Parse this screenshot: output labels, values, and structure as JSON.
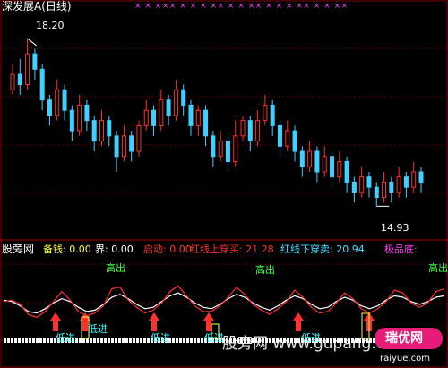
{
  "header": {
    "title": "深发展A(日线)",
    "title_color": "#ffffff",
    "high_marker": "18.20",
    "low_marker": "14.93",
    "x_marks": "× × ×××  × × ×    ×× ×   ×  ××  ×   × ×  ××   ×  ×  ××"
  },
  "indicator_bar": {
    "name": "股旁网",
    "items": [
      {
        "label": "备钱:",
        "value": "0.00",
        "color": "#ffff40"
      },
      {
        "label": "界:",
        "value": "0.00",
        "color": "#ffffff"
      },
      {
        "label": "启动:",
        "value": "0.00",
        "color": "#ff3030"
      },
      {
        "label": "红线上穿买:",
        "value": "21.28",
        "color": "#ff3030"
      },
      {
        "label": "红线下穿卖:",
        "value": "20.94",
        "color": "#40e0ff"
      },
      {
        "label": "极品底:",
        "value": "",
        "color": "#ff40ff"
      }
    ]
  },
  "signals": {
    "sell_text": "高出",
    "buy_text": "低进"
  },
  "watermark": {
    "text": "股旁网 www.gupang.com",
    "badge": "瑞优网",
    "site": "raiyue.com"
  },
  "chart_data": [
    {
      "type": "candlestick",
      "title": "深发展A(日线)",
      "annotations": {
        "high": 18.2,
        "low": 14.93
      },
      "ylim": [
        14.5,
        18.6
      ],
      "colors": {
        "up": "#ff3030",
        "down": "#40d0ff"
      },
      "candles": [
        {
          "o": 17.2,
          "c": 17.5,
          "h": 17.7,
          "l": 17.1
        },
        {
          "o": 17.5,
          "c": 17.3,
          "h": 17.8,
          "l": 17.1
        },
        {
          "o": 17.3,
          "c": 17.9,
          "h": 18.2,
          "l": 17.2
        },
        {
          "o": 17.9,
          "c": 17.6,
          "h": 18.0,
          "l": 17.4
        },
        {
          "o": 17.6,
          "c": 17.0,
          "h": 17.7,
          "l": 16.8
        },
        {
          "o": 17.0,
          "c": 16.7,
          "h": 17.1,
          "l": 16.5
        },
        {
          "o": 16.7,
          "c": 17.2,
          "h": 17.4,
          "l": 16.6
        },
        {
          "o": 17.2,
          "c": 16.8,
          "h": 17.3,
          "l": 16.6
        },
        {
          "o": 16.8,
          "c": 16.4,
          "h": 16.9,
          "l": 16.2
        },
        {
          "o": 16.4,
          "c": 16.9,
          "h": 17.1,
          "l": 16.3
        },
        {
          "o": 16.9,
          "c": 16.6,
          "h": 17.0,
          "l": 16.4
        },
        {
          "o": 16.6,
          "c": 16.2,
          "h": 16.7,
          "l": 16.0
        },
        {
          "o": 16.2,
          "c": 16.6,
          "h": 16.8,
          "l": 16.1
        },
        {
          "o": 16.6,
          "c": 16.3,
          "h": 16.7,
          "l": 16.1
        },
        {
          "o": 16.3,
          "c": 15.9,
          "h": 16.4,
          "l": 15.6
        },
        {
          "o": 15.9,
          "c": 16.3,
          "h": 16.5,
          "l": 15.8
        },
        {
          "o": 16.3,
          "c": 16.0,
          "h": 16.4,
          "l": 15.8
        },
        {
          "o": 16.0,
          "c": 16.5,
          "h": 16.6,
          "l": 15.9
        },
        {
          "o": 16.5,
          "c": 16.8,
          "h": 17.0,
          "l": 16.4
        },
        {
          "o": 16.8,
          "c": 16.5,
          "h": 16.9,
          "l": 16.3
        },
        {
          "o": 16.5,
          "c": 17.0,
          "h": 17.2,
          "l": 16.4
        },
        {
          "o": 17.0,
          "c": 16.7,
          "h": 17.1,
          "l": 16.5
        },
        {
          "o": 16.7,
          "c": 17.2,
          "h": 17.4,
          "l": 16.6
        },
        {
          "o": 17.2,
          "c": 16.9,
          "h": 17.3,
          "l": 16.7
        },
        {
          "o": 16.9,
          "c": 16.5,
          "h": 17.0,
          "l": 16.3
        },
        {
          "o": 16.5,
          "c": 16.8,
          "h": 16.9,
          "l": 16.3
        },
        {
          "o": 16.8,
          "c": 16.3,
          "h": 16.9,
          "l": 16.1
        },
        {
          "o": 16.3,
          "c": 15.9,
          "h": 16.4,
          "l": 15.7
        },
        {
          "o": 15.9,
          "c": 16.2,
          "h": 16.4,
          "l": 15.8
        },
        {
          "o": 16.2,
          "c": 15.8,
          "h": 16.3,
          "l": 15.6
        },
        {
          "o": 15.8,
          "c": 16.3,
          "h": 16.6,
          "l": 15.7
        },
        {
          "o": 16.3,
          "c": 16.6,
          "h": 16.7,
          "l": 16.2
        },
        {
          "o": 16.6,
          "c": 16.2,
          "h": 16.7,
          "l": 16.0
        },
        {
          "o": 16.2,
          "c": 16.6,
          "h": 16.8,
          "l": 16.1
        },
        {
          "o": 16.6,
          "c": 16.9,
          "h": 17.1,
          "l": 16.5
        },
        {
          "o": 16.9,
          "c": 16.5,
          "h": 17.0,
          "l": 16.3
        },
        {
          "o": 16.5,
          "c": 16.1,
          "h": 16.6,
          "l": 15.9
        },
        {
          "o": 16.1,
          "c": 16.4,
          "h": 16.6,
          "l": 16.0
        },
        {
          "o": 16.4,
          "c": 16.0,
          "h": 16.5,
          "l": 15.8
        },
        {
          "o": 16.0,
          "c": 15.7,
          "h": 16.1,
          "l": 15.5
        },
        {
          "o": 15.7,
          "c": 16.0,
          "h": 16.2,
          "l": 15.6
        },
        {
          "o": 16.0,
          "c": 15.6,
          "h": 16.1,
          "l": 15.4
        },
        {
          "o": 15.6,
          "c": 15.9,
          "h": 16.1,
          "l": 15.5
        },
        {
          "o": 15.9,
          "c": 15.5,
          "h": 16.0,
          "l": 15.3
        },
        {
          "o": 15.5,
          "c": 15.8,
          "h": 16.0,
          "l": 15.4
        },
        {
          "o": 15.8,
          "c": 15.4,
          "h": 15.9,
          "l": 15.2
        },
        {
          "o": 15.4,
          "c": 15.2,
          "h": 15.5,
          "l": 15.0
        },
        {
          "o": 15.2,
          "c": 15.5,
          "h": 15.7,
          "l": 15.1
        },
        {
          "o": 15.5,
          "c": 15.3,
          "h": 15.6,
          "l": 15.1
        },
        {
          "o": 15.3,
          "c": 15.1,
          "h": 15.4,
          "l": 14.93
        },
        {
          "o": 15.1,
          "c": 15.4,
          "h": 15.6,
          "l": 15.0
        },
        {
          "o": 15.4,
          "c": 15.2,
          "h": 15.5,
          "l": 15.0
        },
        {
          "o": 15.2,
          "c": 15.5,
          "h": 15.7,
          "l": 15.1
        },
        {
          "o": 15.5,
          "c": 15.3,
          "h": 15.6,
          "l": 15.1
        },
        {
          "o": 15.3,
          "c": 15.6,
          "h": 15.8,
          "l": 15.2
        },
        {
          "o": 15.6,
          "c": 15.4,
          "h": 15.7,
          "l": 15.2
        }
      ]
    },
    {
      "type": "line",
      "series": [
        {
          "name": "",
          "color": "#ffffff",
          "values": [
            46,
            44,
            38,
            30,
            28,
            34,
            42,
            48,
            44,
            36,
            30,
            32,
            40,
            50,
            54,
            48,
            40,
            34,
            36,
            44,
            52,
            56,
            50,
            42,
            36,
            34,
            40,
            48,
            54,
            50,
            42,
            36,
            32,
            38,
            46,
            52,
            48,
            40,
            34,
            36,
            44,
            50,
            46,
            38,
            34,
            38,
            46,
            52,
            50,
            44,
            40,
            44,
            50,
            52
          ]
        },
        {
          "name": "",
          "color": "#ff3030",
          "values": [
            44,
            46,
            40,
            26,
            22,
            30,
            44,
            58,
            46,
            30,
            24,
            28,
            38,
            62,
            64,
            46,
            36,
            28,
            32,
            42,
            58,
            66,
            52,
            38,
            30,
            30,
            38,
            50,
            64,
            54,
            40,
            32,
            26,
            34,
            44,
            60,
            50,
            36,
            28,
            30,
            42,
            56,
            48,
            34,
            28,
            34,
            44,
            60,
            56,
            42,
            36,
            42,
            58,
            62
          ]
        }
      ],
      "ylim": [
        0,
        100
      ]
    }
  ]
}
